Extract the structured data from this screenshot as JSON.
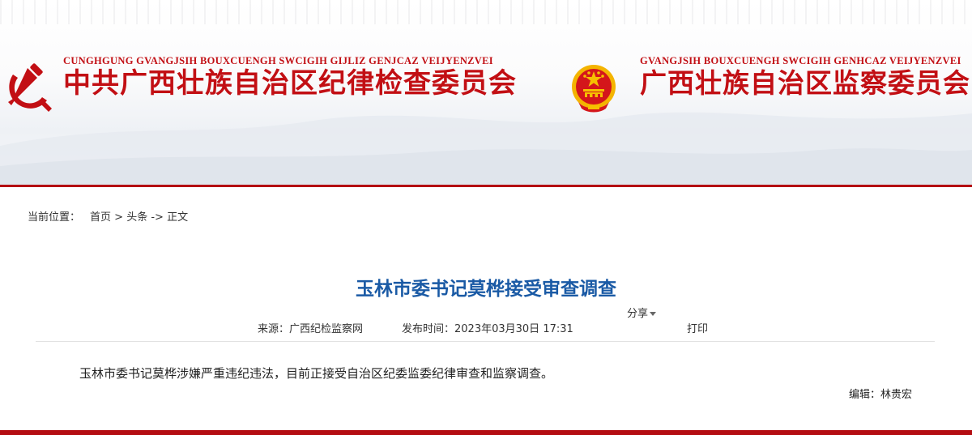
{
  "header": {
    "party": {
      "en": "CUNGHGUNG GVANGJSIH BOUXCUENGH SWCIGIH GIJLIZ GENJCAZ VEIJYENZVEI",
      "cn": "中共广西壮族自治区纪律检查委员会"
    },
    "supervision": {
      "en": "GVANGJSIH BOUXCUENGH SWCIGIH GENHCAZ VEIJYENZVEI",
      "cn": "广西壮族自治区监察委员会"
    },
    "colors": {
      "brand_red": "#c20f14",
      "bar_red": "#b40d12",
      "gold": "#f6c000"
    }
  },
  "breadcrumb": {
    "label": "当前位置：",
    "home": "首页",
    "sep1": " > ",
    "section": "头条",
    "sep2": " -> ",
    "current": "正文"
  },
  "article": {
    "title": "玉林市委书记莫桦接受审查调查",
    "share_label": "分享",
    "source_label": "来源：",
    "source": "广西纪检监察网",
    "time_label": "发布时间：",
    "time": "2023年03月30日 17:31",
    "print_label": "打印",
    "body": "玉林市委书记莫桦涉嫌严重违纪违法，目前正接受自治区纪委监委纪律审查和监察调查。",
    "editor_label": "编辑：",
    "editor": "林贵宏"
  }
}
